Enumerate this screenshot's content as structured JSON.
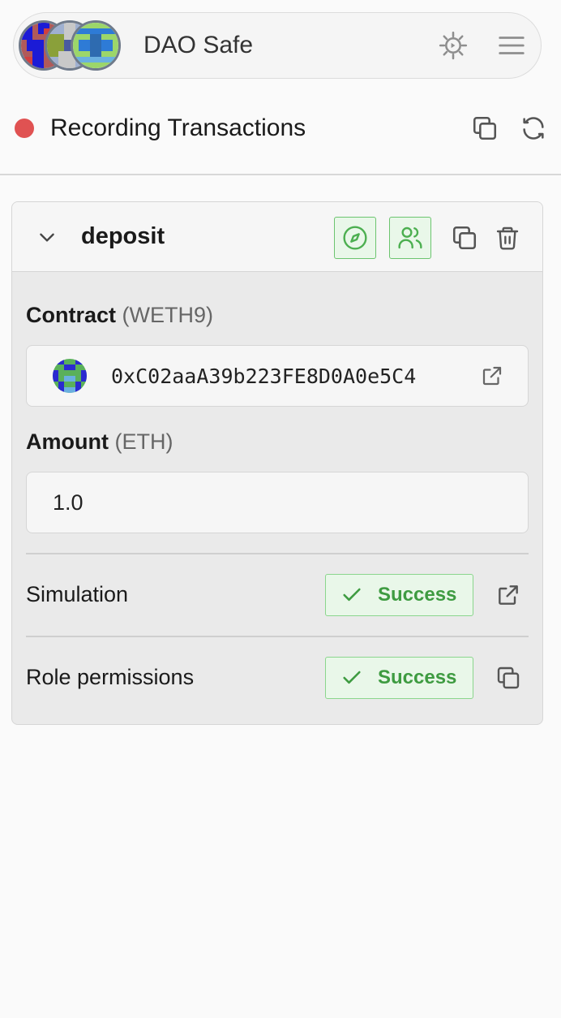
{
  "header": {
    "title": "DAO Safe",
    "avatars": [
      "safe-avatar-1",
      "safe-avatar-2",
      "safe-avatar-3"
    ],
    "icons": {
      "settings": "gear-icon",
      "menu": "menu-icon"
    }
  },
  "recording": {
    "label": "Recording Transactions",
    "status_color": "#e05252",
    "icons": {
      "copy": "copy-icon",
      "reset": "refresh-icon"
    }
  },
  "transaction": {
    "title": "deposit",
    "contract": {
      "label": "Contract",
      "name": "(WETH9)",
      "address": "0xC02aaA39b223FE8D0A0e5C4"
    },
    "amount": {
      "label": "Amount",
      "unit": "(ETH)",
      "value": "1.0"
    },
    "checks": [
      {
        "label": "Simulation",
        "status": "Success"
      },
      {
        "label": "Role permissions",
        "status": "Success"
      }
    ]
  },
  "colors": {
    "success_green": "#3e9b41",
    "success_bg": "#e9f7e9",
    "recording_red": "#e05252"
  }
}
